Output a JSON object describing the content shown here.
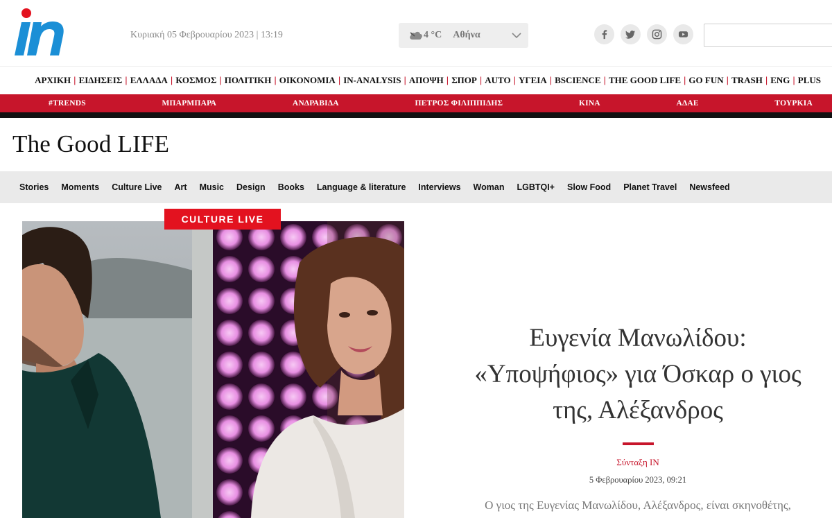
{
  "header": {
    "logo_text": "in",
    "date_time": "Κυριακή 05 Φεβρουαρίου 2023 | 13:19",
    "weather": {
      "icon": "cloud-icon",
      "temperature": "4 °C",
      "city": "Αθήνα"
    },
    "social": [
      "facebook-icon",
      "twitter-icon",
      "instagram-icon",
      "youtube-icon"
    ],
    "search_placeholder": ""
  },
  "main_nav": [
    "ΑΡΧΙΚΗ",
    "ΕΙΔΗΣΕΙΣ",
    "ΕΛΛΑΔΑ",
    "ΚΟΣΜΟΣ",
    "ΠΟΛΙΤΙΚΗ",
    "ΟΙΚΟΝΟΜΙΑ",
    "IN-ANALYSIS",
    "ΑΠΟΨΗ",
    "ΣΠΟΡ",
    "AUTO",
    "ΥΓΕΙΑ",
    "BSCIENCE",
    "THE GOOD LIFE",
    "GO FUN",
    "TRASH",
    "ENG",
    "PLUS"
  ],
  "trends": [
    "#TRENDS",
    "ΜΠΑΡΜΠΑΡΑ",
    "ΑΝΔΡΑΒΙΔΑ",
    "ΠΕΤΡΟΣ ΦΙΛΙΠΠΙΔΗΣ",
    "ΚΙΝΑ",
    "ΑΔΑΕ",
    "ΤΟΥΡΚΙΑ"
  ],
  "section": {
    "title": "The Good LIFE"
  },
  "sub_nav": [
    "Stories",
    "Moments",
    "Culture Live",
    "Art",
    "Music",
    "Design",
    "Books",
    "Language & literature",
    "Interviews",
    "Woman",
    "LGBTQI+",
    "Slow Food",
    "Planet Travel",
    "Newsfeed"
  ],
  "article": {
    "category": "CULTURE LIVE",
    "headline_lines": [
      "Ευγενία Μανωλίδου:",
      "«Υποψήφιος» για Όσκαρ ο γιος",
      "της, Αλέξανδρος"
    ],
    "author": "Σύνταξη IN",
    "date": "5 Φεβρουαρίου 2023, 09:21",
    "excerpt": "Ο γιος της Ευγενίας Μανωλίδου, Αλέξανδρος, είναι σκηνοθέτης,"
  },
  "colors": {
    "brand_blue": "#1b8fd6",
    "accent_red": "#c7152b",
    "badge_red": "#e3121f"
  }
}
